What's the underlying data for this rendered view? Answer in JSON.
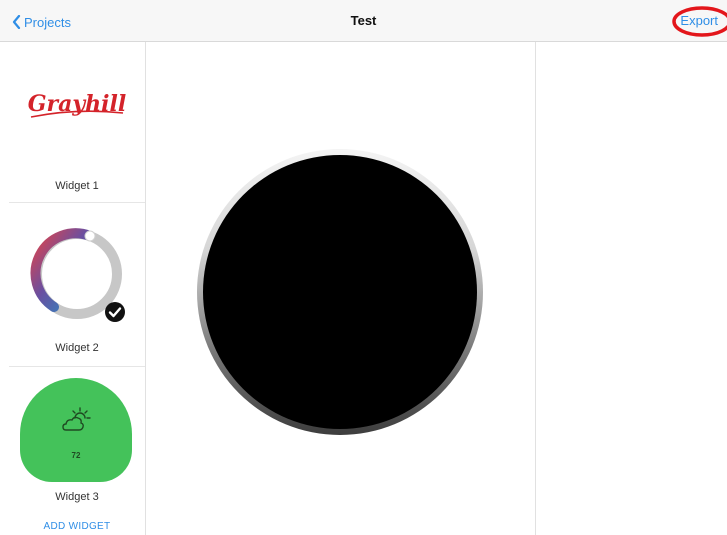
{
  "nav": {
    "back_label": "Projects",
    "title": "Test",
    "export_label": "Export"
  },
  "sidebar": {
    "widgets": [
      {
        "label": "Widget 1",
        "content": "Grayhill"
      },
      {
        "label": "Widget 2"
      },
      {
        "label": "Widget 3",
        "temperature": "72"
      }
    ],
    "add_label": "ADD WIDGET"
  },
  "colors": {
    "accent": "#2f8ee6",
    "export_highlight": "#e3161b",
    "widget3_bg": "#44c25a",
    "logo_red": "#d4232a"
  },
  "icons": [
    "chevron-left-icon",
    "checkmark-badge-icon",
    "partly-sunny-icon"
  ]
}
